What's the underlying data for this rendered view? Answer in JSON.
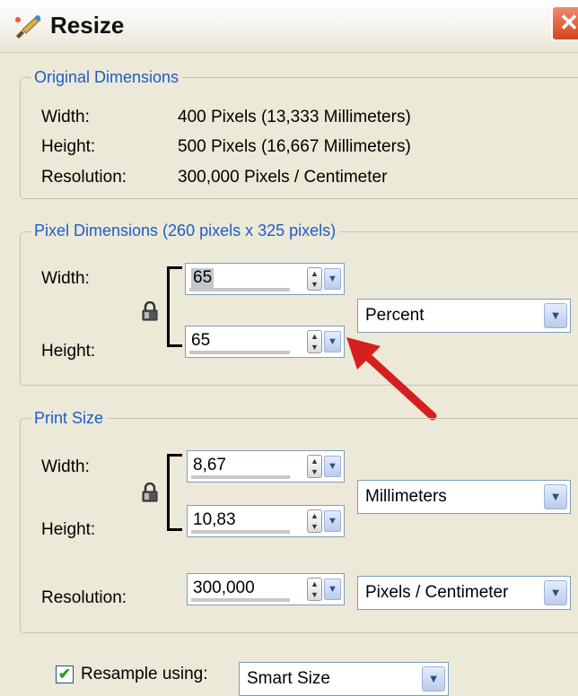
{
  "window": {
    "title": "Resize",
    "close_glyph": "✕"
  },
  "original": {
    "title": "Original Dimensions",
    "width_label": "Width:",
    "width_value": "400 Pixels (13,333 Millimeters)",
    "height_label": "Height:",
    "height_value": "500 Pixels (16,667 Millimeters)",
    "resolution_label": "Resolution:",
    "resolution_value": "300,000 Pixels / Centimeter"
  },
  "pixel": {
    "title": "Pixel Dimensions (260 pixels x 325 pixels)",
    "width_label": "Width:",
    "width_value": "65",
    "height_label": "Height:",
    "height_value": "65",
    "unit": "Percent"
  },
  "print": {
    "title": "Print Size",
    "width_label": "Width:",
    "width_value": "8,67",
    "height_label": "Height:",
    "height_value": "10,83",
    "unit": "Millimeters",
    "resolution_label": "Resolution:",
    "resolution_value": "300,000",
    "resolution_unit": "Pixels / Centimeter"
  },
  "resample": {
    "checked": true,
    "check_glyph": "✔",
    "label": "Resample using:",
    "method": "Smart Size"
  },
  "glyphs": {
    "spin_up": "▲",
    "spin_down": "▼",
    "dropdown": "▼"
  },
  "colors": {
    "group_title": "#1e5cc6",
    "annotation_arrow": "#d61f1f"
  },
  "icons": {
    "app": "paint-brush-icon",
    "lock": "lock-icon",
    "annotation": "red-arrow-annotation"
  }
}
